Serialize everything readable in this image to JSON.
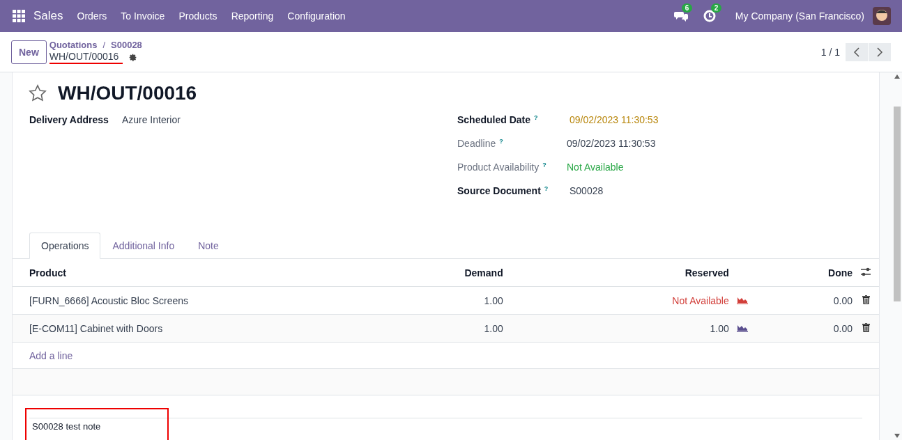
{
  "navbar": {
    "app": "Sales",
    "menu": [
      "Orders",
      "To Invoice",
      "Products",
      "Reporting",
      "Configuration"
    ],
    "messages_count": "6",
    "activities_count": "2",
    "company": "My Company (San Francisco)"
  },
  "control_panel": {
    "new_button": "New",
    "breadcrumbs": [
      "Quotations",
      "S00028"
    ],
    "breadcrumb_separator": "/",
    "current": "WH/OUT/00016",
    "current_annotated": true,
    "pager": "1 / 1"
  },
  "record": {
    "title": "WH/OUT/00016",
    "starred": false,
    "left_fields": [
      {
        "label": "Delivery Address",
        "value": "Azure Interior",
        "required": true,
        "color": "#374151"
      }
    ],
    "right_fields": [
      {
        "label": "Scheduled Date",
        "help": "?",
        "value": "09/02/2023 11:30:53",
        "required": true,
        "color": "#b8860b"
      },
      {
        "label": "Deadline",
        "help": "?",
        "value": "09/02/2023 11:30:53",
        "required": false,
        "color": "#374151"
      },
      {
        "label": "Product Availability",
        "help": "?",
        "value": "Not Available",
        "required": false,
        "color": "#28a745"
      },
      {
        "label": "Source Document",
        "help": "?",
        "value": "S00028",
        "required": true,
        "color": "#374151"
      }
    ]
  },
  "tabs": [
    {
      "label": "Operations",
      "selected": true
    },
    {
      "label": "Additional Info",
      "selected": false
    },
    {
      "label": "Note",
      "selected": false
    }
  ],
  "table": {
    "columns": [
      "Product",
      "Demand",
      "Reserved",
      "Done"
    ],
    "rows": [
      {
        "product": "[FURN_6666] Acoustic Bloc Screens",
        "demand": "1.00",
        "reserved": "Not Available",
        "available": false,
        "done": "0.00"
      },
      {
        "product": "[E-COM11] Cabinet with Doors",
        "demand": "1.00",
        "reserved": "1.00",
        "available": true,
        "done": "0.00"
      }
    ],
    "add_line": "Add a line"
  },
  "note": {
    "text": "S00028 test note",
    "annotated": true
  }
}
